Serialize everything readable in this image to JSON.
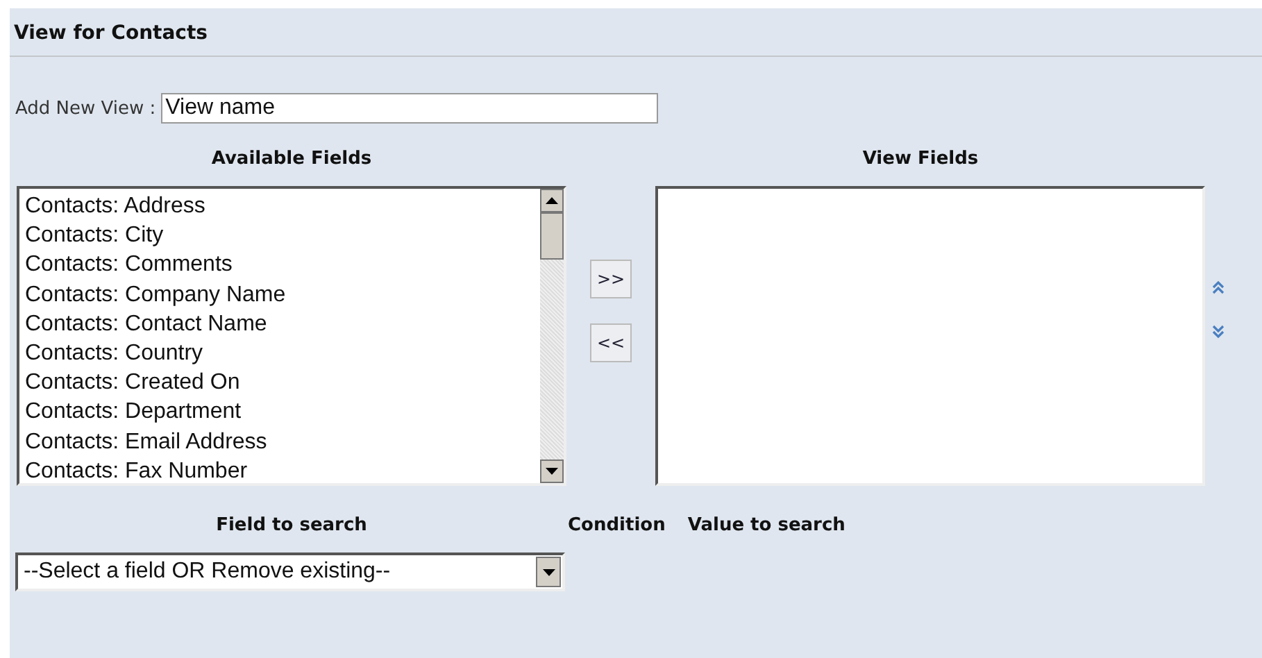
{
  "panel": {
    "title": "View for Contacts"
  },
  "new_view": {
    "label": "Add New View :",
    "value": "View name"
  },
  "available_fields": {
    "heading": "Available Fields",
    "items": [
      "Contacts: Address",
      "Contacts: City",
      "Contacts: Comments",
      "Contacts: Company Name",
      "Contacts: Contact Name",
      "Contacts: Country",
      "Contacts: Created On",
      "Contacts: Department",
      "Contacts: Email Address",
      "Contacts: Fax Number"
    ]
  },
  "move_buttons": [
    {
      "label": ">>"
    },
    {
      "label": "<<"
    }
  ],
  "view_fields": {
    "heading": "View Fields"
  },
  "search": {
    "field_heading": "Field to search",
    "condition_heading": "Condition",
    "value_heading": "Value to search",
    "field_select": "--Select a field OR Remove existing--"
  }
}
